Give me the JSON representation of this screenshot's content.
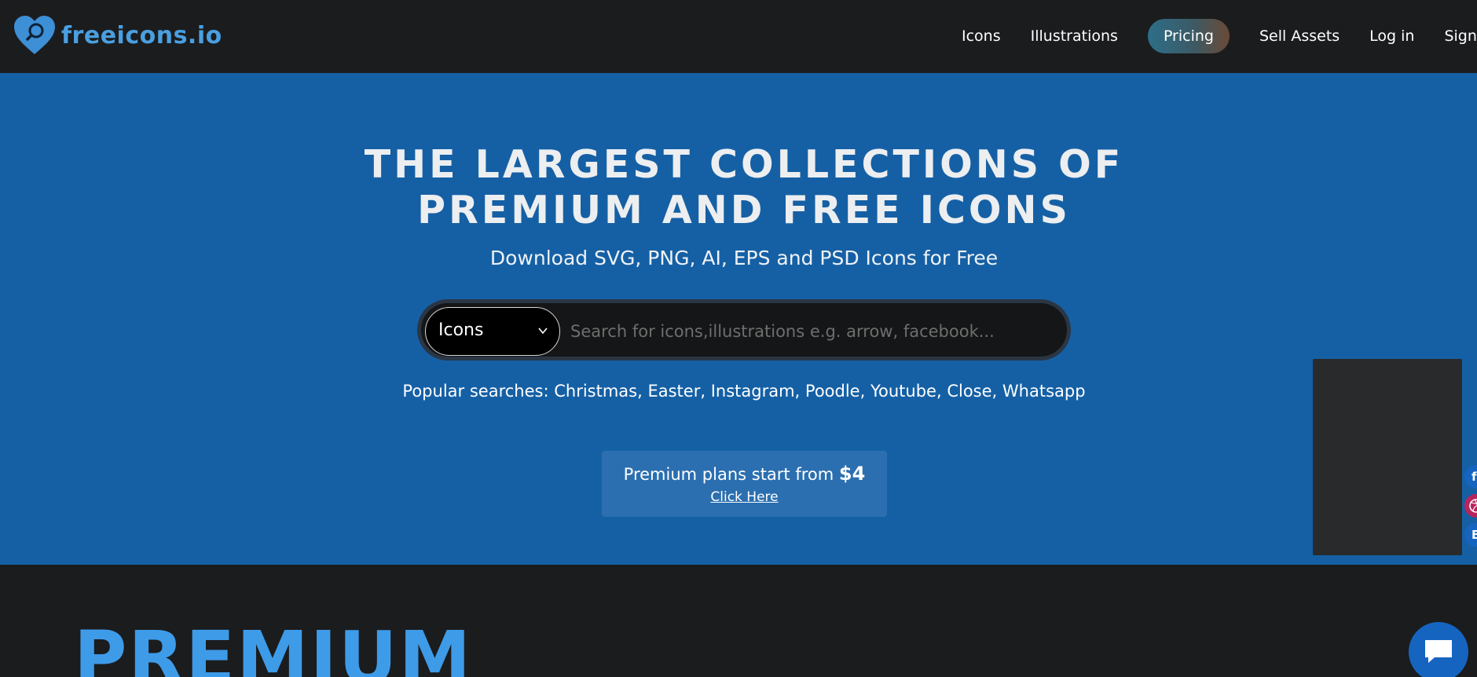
{
  "brand": {
    "name": "freeicons.io",
    "color": "#4a9fe0"
  },
  "nav": {
    "icons": "Icons",
    "illustrations": "Illustrations",
    "pricing": "Pricing",
    "sell_assets": "Sell Assets",
    "login": "Log in",
    "signup": "Sign up"
  },
  "hero": {
    "title_line1": "THE LARGEST COLLECTIONS OF",
    "title_line2": "PREMIUM AND FREE ICONS",
    "subtitle": "Download SVG, PNG, AI, EPS and PSD Icons for Free",
    "background": "#1560a5"
  },
  "search": {
    "category": "Icons",
    "placeholder": "Search for icons,illustrations e.g. arrow, facebook..."
  },
  "popular": {
    "label": "Popular searches:",
    "terms": [
      "Christmas",
      "Easter",
      "Instagram",
      "Poodle",
      "Youtube",
      "Close",
      "Whatsapp"
    ]
  },
  "premium": {
    "text": "Premium plans start from",
    "price": "$4",
    "link": "Click Here"
  },
  "social": {
    "facebook_letter": "f",
    "behance_letter": "B",
    "icons": [
      "facebook-icon",
      "dribbble-icon",
      "behance-icon"
    ]
  },
  "section": {
    "title": "PREMIUM"
  },
  "chat": {
    "icon": "chat-bubble-icon"
  }
}
